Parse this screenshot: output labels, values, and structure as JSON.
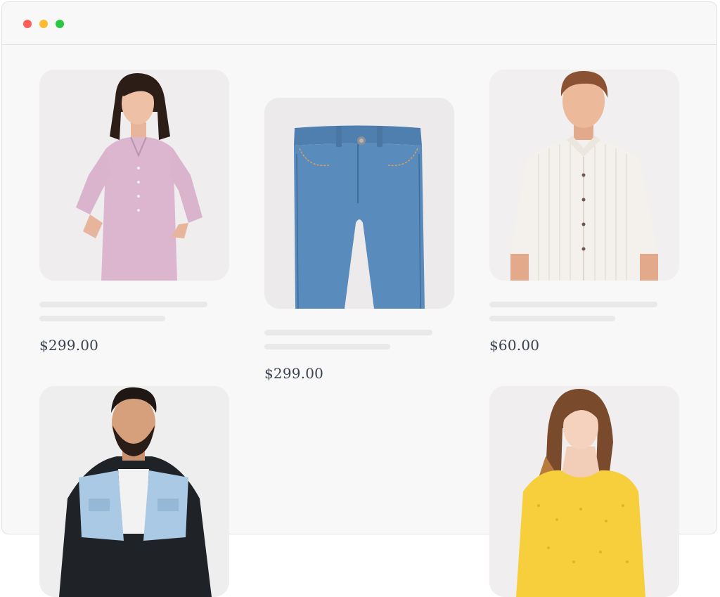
{
  "window": {
    "controls": [
      {
        "name": "close",
        "color": "#ff5f57"
      },
      {
        "name": "minimize",
        "color": "#febc2e"
      },
      {
        "name": "maximize",
        "color": "#28c840"
      }
    ]
  },
  "products": [
    {
      "image": "woman-pink-striped-kurta",
      "price": "$299.00"
    },
    {
      "image": "kids-blue-denim-jeans",
      "price": "$299.00"
    },
    {
      "image": "man-white-striped-shirt",
      "price": "$60.00"
    },
    {
      "image": "man-denim-vest-hoodie",
      "price": null
    },
    {
      "image": "woman-yellow-floral-top",
      "price": null
    }
  ]
}
